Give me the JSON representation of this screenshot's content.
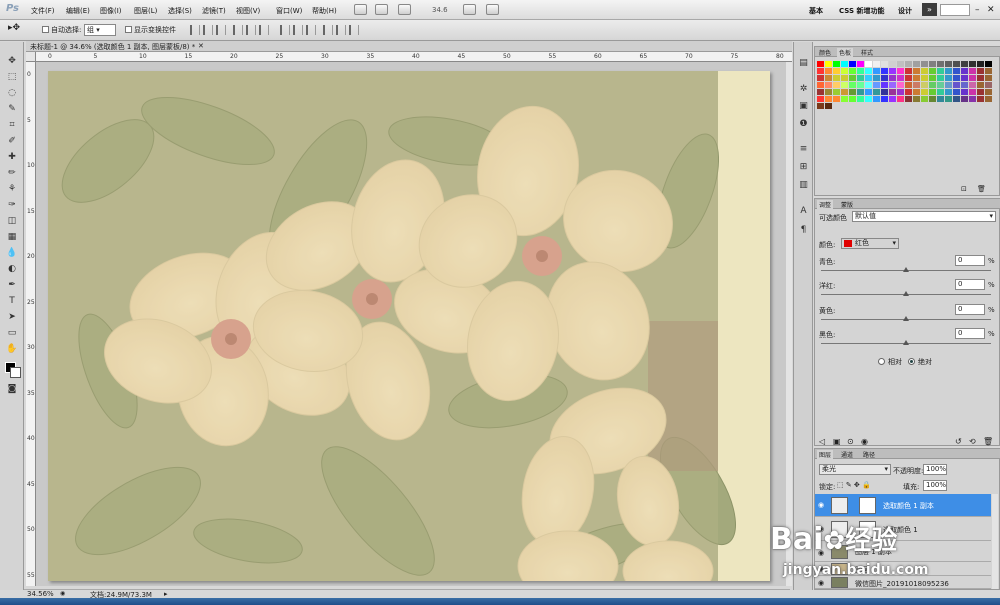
{
  "app": {
    "logo": "Ps"
  },
  "menu": [
    "文件(F)",
    "编辑(E)",
    "图像(I)",
    "图层(L)",
    "选择(S)",
    "滤镜(T)",
    "视图(V)",
    "窗口(W)",
    "帮助(H)"
  ],
  "menubar": {
    "zoom": "34.6",
    "workspaces": [
      "基本",
      "CSS 新增功能",
      "设计"
    ],
    "chev": "»"
  },
  "options": {
    "auto_select": "自动选择:",
    "auto_select_value": "组",
    "show_transform": "显示变换控件"
  },
  "document": {
    "tab": "未标题-1 @ 34.6% (选取颜色 1 副本, 图层蒙板/8) *",
    "close": "✕"
  },
  "status": {
    "zoom": "34.56%",
    "doc_info": "文档:24.9M/73.3M"
  },
  "ruler_top": [
    "0",
    "5",
    "10",
    "15",
    "20",
    "25",
    "30",
    "35",
    "40",
    "45",
    "50",
    "55",
    "60",
    "65",
    "70",
    "75",
    "80"
  ],
  "ruler_left": [
    "0",
    "5",
    "10",
    "15",
    "20",
    "25",
    "30",
    "35",
    "40",
    "45",
    "50",
    "55"
  ],
  "tools": [
    "move-tool-icon",
    "marquee-tool-icon",
    "lasso-tool-icon",
    "quick-select-tool-icon",
    "crop-tool-icon",
    "eyedropper-tool-icon",
    "healing-brush-icon",
    "brush-tool-icon",
    "clone-stamp-icon",
    "history-brush-icon",
    "eraser-tool-icon",
    "gradient-tool-icon",
    "blur-tool-icon",
    "dodge-tool-icon",
    "pen-tool-icon",
    "type-tool-icon",
    "path-select-icon",
    "shape-tool-icon",
    "hand-tool-icon",
    "zoom-tool-icon"
  ],
  "tool_glyphs": [
    "✥",
    "⬚",
    "◌",
    "✎",
    "⌗",
    "✐",
    "✚",
    "✏",
    "⚘",
    "✑",
    "◫",
    "▦",
    "💧",
    "◐",
    "✒",
    "T",
    "➤",
    "▭",
    "✋",
    "🔍"
  ],
  "swatch_panel": {
    "tabs": [
      "颜色",
      "色板",
      "样式"
    ]
  },
  "adjust_panel": {
    "tabs": [
      "调整",
      "蒙版"
    ],
    "title": "可选颜色",
    "preset": "默认值",
    "color_label": "颜色:",
    "color_value": "红色",
    "color_swatch": "#e00000",
    "sliders": [
      {
        "label": "青色:",
        "value": "0",
        "unit": "%"
      },
      {
        "label": "洋红:",
        "value": "0",
        "unit": "%"
      },
      {
        "label": "黄色:",
        "value": "0",
        "unit": "%"
      },
      {
        "label": "黑色:",
        "value": "0",
        "unit": "%"
      }
    ],
    "method": {
      "relative": "相对",
      "absolute": "绝对",
      "selected": "absolute"
    }
  },
  "layers_panel": {
    "tabs": [
      "图层",
      "通道",
      "路径"
    ],
    "blend": "柔光",
    "opacity_label": "不透明度:",
    "opacity": "100%",
    "lock_label": "锁定:",
    "fill_label": "填充:",
    "fill": "100%",
    "layers": [
      {
        "name": "选取颜色 1 副本",
        "selected": true
      },
      {
        "name": "选取颜色 1",
        "selected": false
      },
      {
        "name": "图层 1 副本",
        "selected": false
      },
      {
        "name": "图层 1",
        "selected": false
      },
      {
        "name": "微信图片_20191018095236",
        "selected": false
      }
    ]
  },
  "watermark": {
    "brand": "Bai",
    "brand2": "经验",
    "url": "jingyan.baidu.com"
  }
}
